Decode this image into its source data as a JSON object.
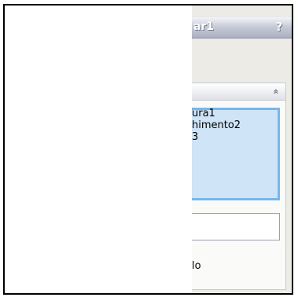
{
  "property_manager": {
    "title": "ar1",
    "help_label": "?",
    "group": {
      "collapse_glyph": "»",
      "selection_items": [
        "ura1",
        "himento2",
        "3"
      ],
      "input_value": "",
      "option_label": "lo"
    }
  },
  "colors": {
    "title_bar": "#aab0c2",
    "panel_bg": "#ecebe6",
    "list_bg": "#cfe4f7",
    "list_border": "#75b7ec"
  }
}
